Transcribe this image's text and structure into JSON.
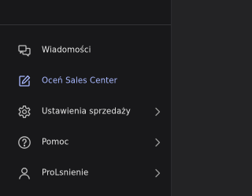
{
  "colors": {
    "panel_bg": "#18181a",
    "page_bg": "#232325",
    "text": "#e6e6e6",
    "accent": "#a9b9ff",
    "icon": "#bdbdbd",
    "chevron": "#9a9a9a"
  },
  "menu": {
    "items": [
      {
        "label": "Wiadomości",
        "icon": "chat-icon",
        "has_chevron": false,
        "accent": false
      },
      {
        "label": "Oceń Sales Center",
        "icon": "edit-feedback-icon",
        "has_chevron": false,
        "accent": true
      },
      {
        "label": "Ustawienia sprzedaży",
        "icon": "gear-icon",
        "has_chevron": true,
        "accent": false
      },
      {
        "label": "Pomoc",
        "icon": "help-icon",
        "has_chevron": true,
        "accent": false
      },
      {
        "label": "ProLsnienie",
        "icon": "user-icon",
        "has_chevron": true,
        "accent": false
      }
    ]
  }
}
